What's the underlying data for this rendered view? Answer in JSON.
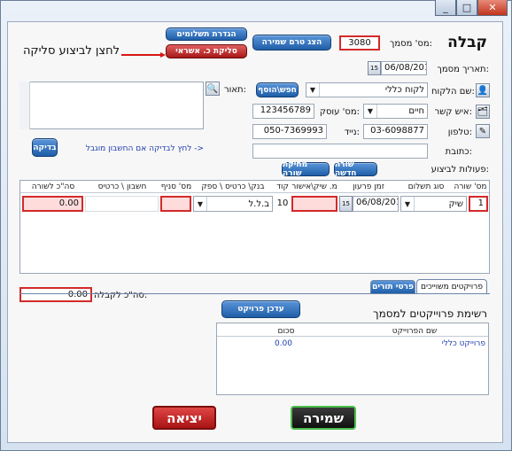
{
  "header": {
    "title": "קבלה",
    "doc_number_label": "מס' מסמך:",
    "doc_number": "3080",
    "show_before_save": "הצג טרם שמירה",
    "payment_settings": "הגדרת תשלומים",
    "credit_clearing": "סליקת כ. אשראי",
    "annotation": "לחצן לביצוע סליקה",
    "date_label": "תאריך מסמך:",
    "date": "06/08/2015"
  },
  "customer": {
    "name_label": "שם הלקוח:",
    "name": "לקוח כללי",
    "search_button": "חפש\\הוסף",
    "contact_label": "איש קשר:",
    "contact": "חיים",
    "dealer_label": "מס' עוסק:",
    "dealer": "123456789",
    "phone_label": "טלפון:",
    "phone": "03-6098877",
    "mobile_label": "נייד:",
    "mobile": "050-7369993",
    "address_label": "כתובת:",
    "address": "",
    "description_label": "תאור:",
    "description": ""
  },
  "check": {
    "button": "בדיקה",
    "hint": "לחץ לבדיקה אם החשבון מוגבל ->"
  },
  "actions": {
    "label": "פעולות לביצוע:",
    "new_row": "שורה חדשה",
    "delete_row": "מחיקת שורה"
  },
  "table": {
    "headers": [
      "מס' שורה",
      "סוג תשלום",
      "זמן פרעון",
      "מ. שיק\\אישור",
      "קוד",
      "בנק\\ כרטיס \\ ספק",
      "מס' סניף",
      "חשבון \\ כרטיס",
      "סה\"כ לשורה"
    ],
    "row": {
      "num": "1",
      "type": "שיק",
      "due": "06/08/2015",
      "check_no": "",
      "code": "10",
      "bank": "ב.ל.ל",
      "branch": "",
      "account": "",
      "total": "0.00"
    }
  },
  "receipt_total": {
    "label": "סה\"כ לקבלה:",
    "value": "0.00"
  },
  "tabs": [
    {
      "label": "פרויקטים משוייכים"
    },
    {
      "label": "פרטי תורים"
    }
  ],
  "projects": {
    "update_button": "עדכן פרויקט",
    "title": "רשימת פרוייקטים למסמך",
    "headers": [
      "שם הפרוייקט",
      "סכום"
    ],
    "rows": [
      {
        "name": "פרוייקט כללי",
        "amount": "0.00"
      }
    ]
  },
  "footer": {
    "save": "שמירה",
    "exit": "יציאה"
  }
}
